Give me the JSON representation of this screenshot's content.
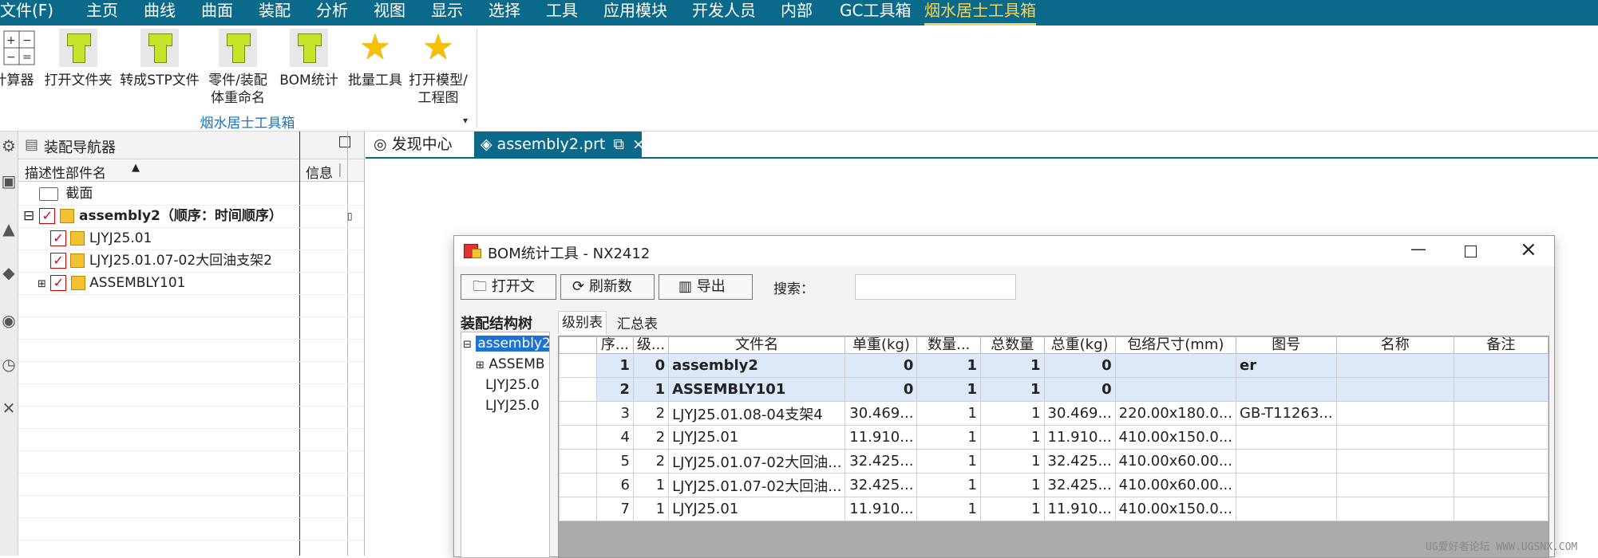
{
  "menu": {
    "items": [
      "文件(F)",
      "主页",
      "曲线",
      "曲面",
      "装配",
      "分析",
      "视图",
      "显示",
      "选择",
      "工具",
      "应用模块",
      "开发人员",
      "内部",
      "GC工具箱",
      "烟水居士工具箱"
    ],
    "active_index": 14
  },
  "ribbon": {
    "buttons": [
      {
        "label": "计算器",
        "icon": "calculator-icon"
      },
      {
        "label": "打开文件夹",
        "icon": "plug-icon"
      },
      {
        "label": "转成STP文件",
        "icon": "plug-icon"
      },
      {
        "label": "零件/装配体重命名",
        "icon": "plug-icon"
      },
      {
        "label": "BOM统计",
        "icon": "plug-icon"
      },
      {
        "label": "批量工具",
        "icon": "star-icon"
      },
      {
        "label": "打开模型/工程图",
        "icon": "star-icon"
      }
    ],
    "group_label": "烟水居士工具箱",
    "colors": {
      "menubar": "#0b6a8a",
      "active_menu": "#f4d35e",
      "group_label": "#1a73c0"
    }
  },
  "navigator": {
    "title": "装配导航器",
    "col_name": "描述性部件名",
    "col_info": "信息",
    "rows": [
      {
        "label": "截面",
        "kind": "folder"
      },
      {
        "label": "assembly2（顺序：时间顺序）",
        "kind": "assembly-root"
      },
      {
        "label": "LJYJ25.01",
        "kind": "part"
      },
      {
        "label": "LJYJ25.01.07-02大回油支架2",
        "kind": "part"
      },
      {
        "label": "ASSEMBLY101",
        "kind": "subassembly"
      }
    ]
  },
  "tabs": [
    {
      "label": "发现中心"
    },
    {
      "label": "assembly2.prt"
    }
  ],
  "dialog": {
    "title": "BOM统计工具 - NX2412",
    "buttons": {
      "open": "打开文",
      "refresh": "刷新数",
      "export": "导出"
    },
    "search_label": "搜索：",
    "search_value": "",
    "tree_label": "装配结构树",
    "tree_items": [
      "assembly2",
      "ASSEMB",
      "LJYJ25.0",
      "LJYJ25.0"
    ],
    "subtabs": [
      "级别表",
      "汇总表"
    ],
    "columns": [
      "序...",
      "级...",
      "文件名",
      "单重(kg)",
      "数量...",
      "总数量",
      "总重(kg)",
      "包络尺寸(mm)",
      "图号",
      "名称",
      "备注"
    ],
    "rows": [
      {
        "seq": "1",
        "level": "0",
        "file": "assembly2",
        "unit_w": "0",
        "qty": "1",
        "total_qty": "1",
        "total_w": "0",
        "bbox": "",
        "drawing": "er",
        "name": "",
        "note": "",
        "bold": true
      },
      {
        "seq": "2",
        "level": "1",
        "file": "ASSEMBLY101",
        "unit_w": "0",
        "qty": "1",
        "total_qty": "1",
        "total_w": "0",
        "bbox": "",
        "drawing": "",
        "name": "",
        "note": "",
        "bold": true
      },
      {
        "seq": "3",
        "level": "2",
        "file": "LJYJ25.01.08-04支架4",
        "unit_w": "30.469...",
        "qty": "1",
        "total_qty": "1",
        "total_w": "30.469...",
        "bbox": "220.00x180.0...",
        "drawing": "GB-T11263...",
        "name": "",
        "note": "",
        "bold": false
      },
      {
        "seq": "4",
        "level": "2",
        "file": "LJYJ25.01",
        "unit_w": "11.910...",
        "qty": "1",
        "total_qty": "1",
        "total_w": "11.910...",
        "bbox": "410.00x150.0...",
        "drawing": "",
        "name": "",
        "note": "",
        "bold": false
      },
      {
        "seq": "5",
        "level": "2",
        "file": "LJYJ25.01.07-02大回油...",
        "unit_w": "32.425...",
        "qty": "1",
        "total_qty": "1",
        "total_w": "32.425...",
        "bbox": "410.00x60.00...",
        "drawing": "",
        "name": "",
        "note": "",
        "bold": false
      },
      {
        "seq": "6",
        "level": "1",
        "file": "LJYJ25.01.07-02大回油...",
        "unit_w": "32.425...",
        "qty": "1",
        "total_qty": "1",
        "total_w": "32.425...",
        "bbox": "410.00x60.00...",
        "drawing": "",
        "name": "",
        "note": "",
        "bold": false
      },
      {
        "seq": "7",
        "level": "1",
        "file": "LJYJ25.01",
        "unit_w": "11.910...",
        "qty": "1",
        "total_qty": "1",
        "total_w": "11.910...",
        "bbox": "410.00x150.0...",
        "drawing": "",
        "name": "",
        "note": "",
        "bold": false
      }
    ]
  },
  "watermark": "UG爱好者论坛 WWW.UGSNX.COM"
}
